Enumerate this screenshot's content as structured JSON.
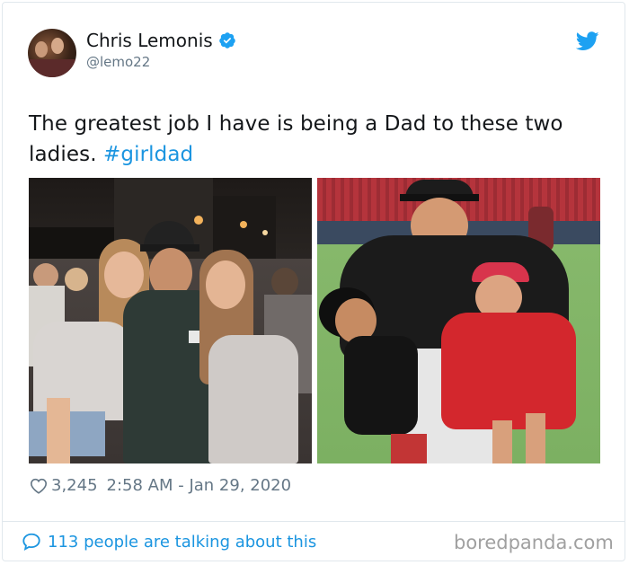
{
  "tweet": {
    "author_name": "Chris Lemonis",
    "author_handle": "@lemo22",
    "text_main": "The greatest job I have is being a Dad to these two ladies.",
    "hashtag": "#girldad",
    "likes": "3,245",
    "timestamp": "2:58 AM - Jan 29, 2020",
    "talking": "113 people are talking about this"
  },
  "icons": {
    "verified": "verified-badge-icon",
    "bird": "twitter-bird-icon",
    "heart": "heart-icon",
    "bubble": "speech-bubble-icon"
  },
  "colors": {
    "accent": "#1b95e0",
    "verified": "#1da1f2",
    "meta": "#657786"
  },
  "watermark": "boredpanda.com"
}
